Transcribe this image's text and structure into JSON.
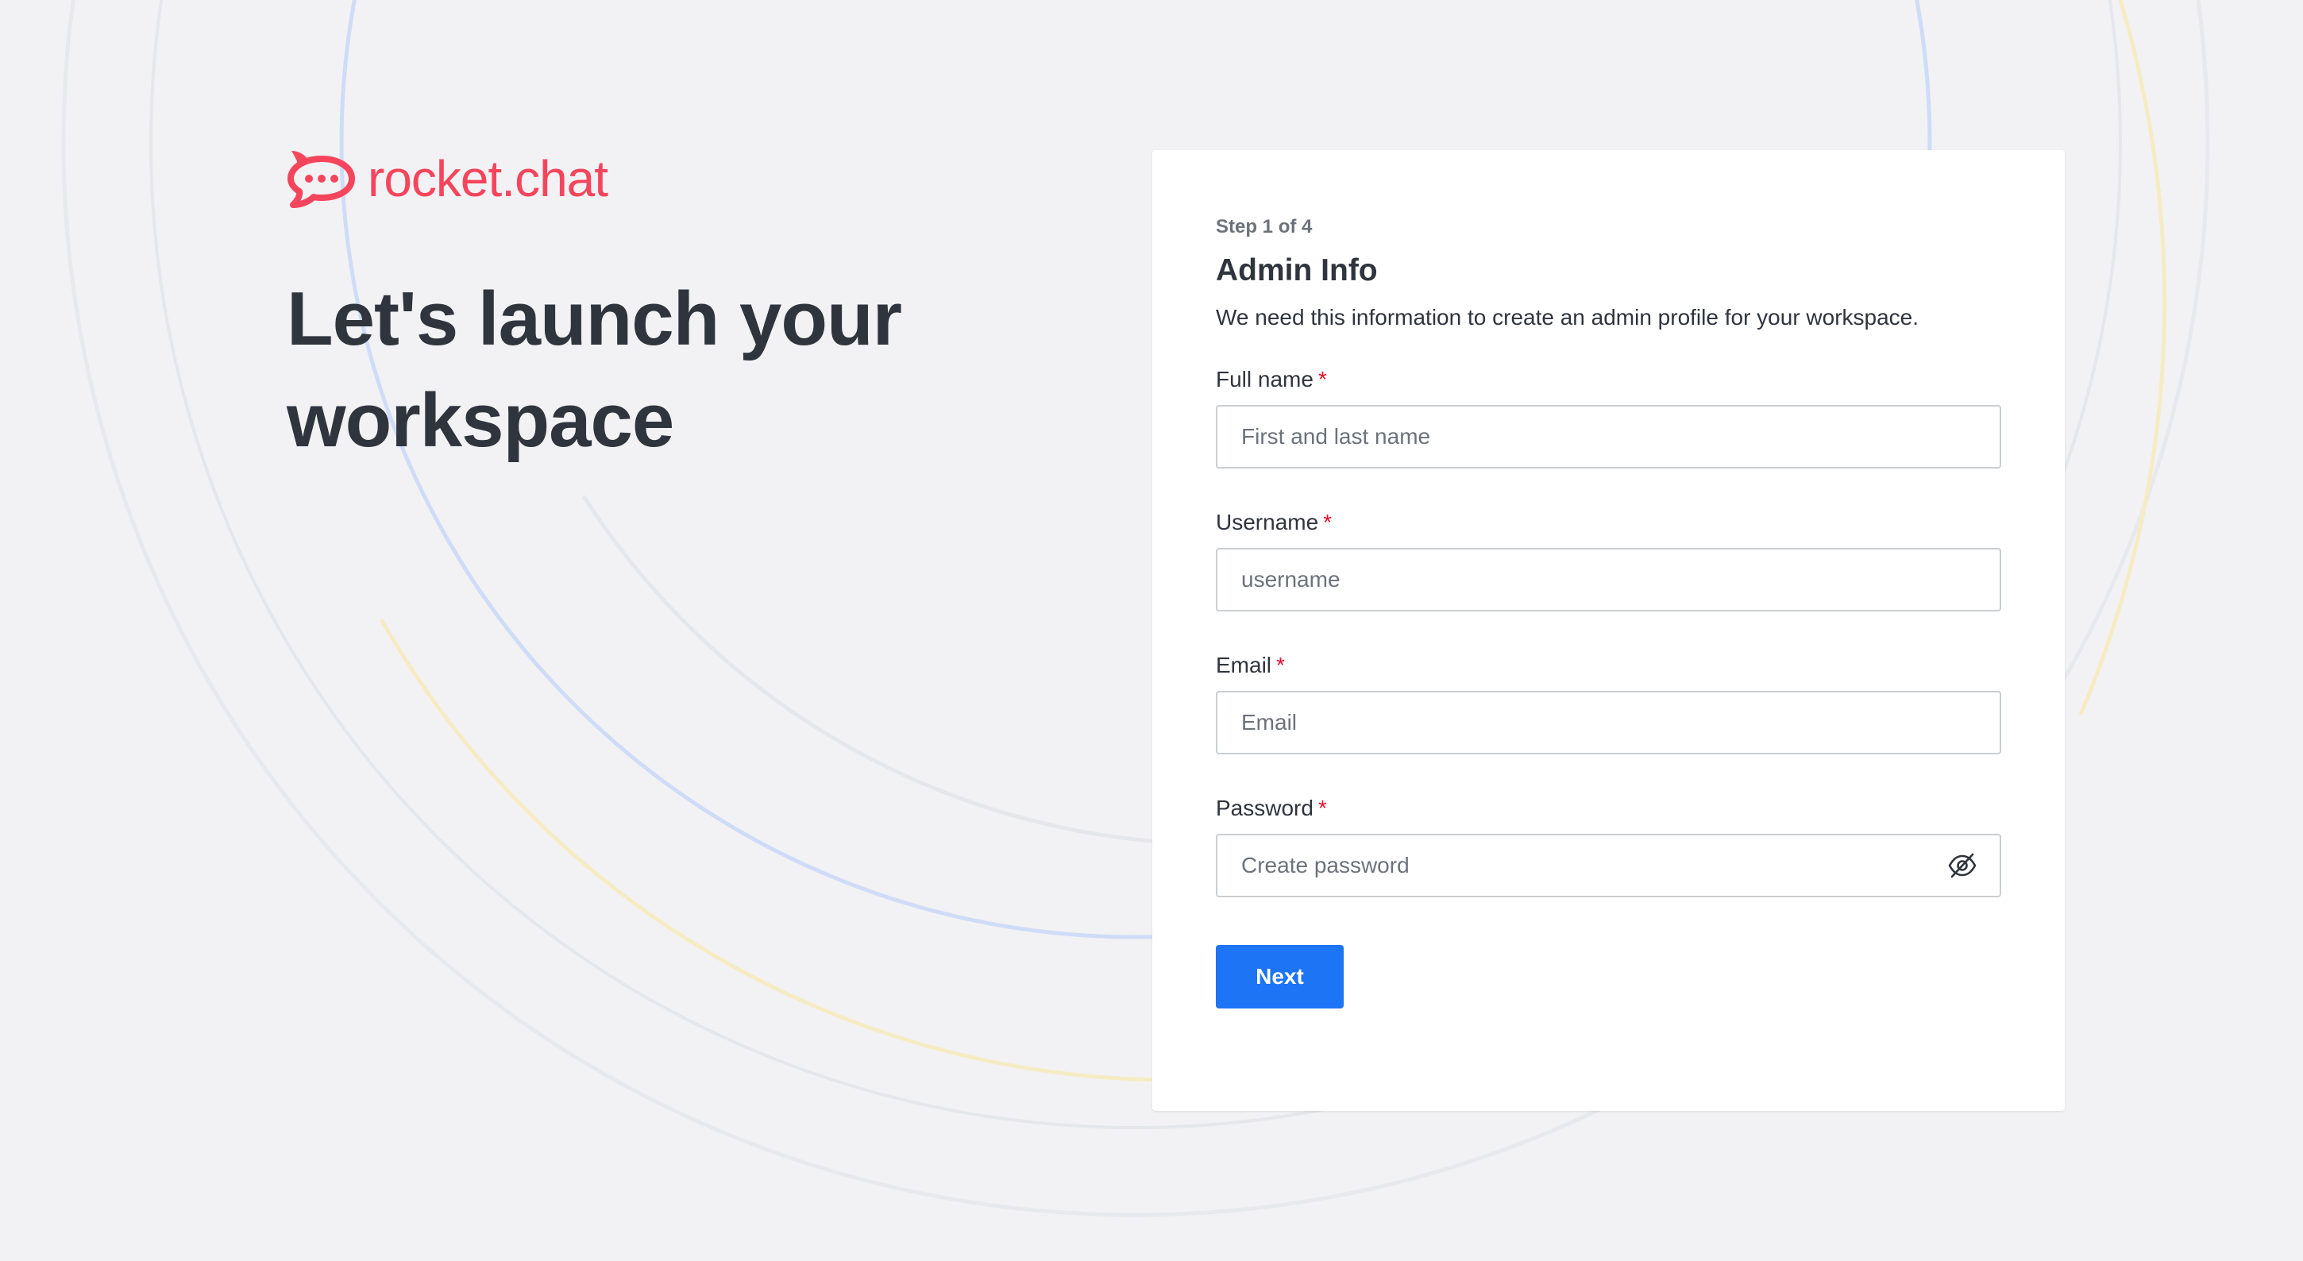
{
  "brand": {
    "name": "rocket.chat",
    "logo_icon": "rocket-chat-logo-icon",
    "color": "#f5455c"
  },
  "hero": {
    "title": "Let's launch your workspace"
  },
  "form": {
    "step": "Step 1 of 4",
    "title": "Admin Info",
    "description": "We need this information to create an admin profile for your workspace.",
    "required_marker": "*",
    "fields": {
      "full_name": {
        "label": "Full name",
        "placeholder": "First and last name",
        "value": ""
      },
      "username": {
        "label": "Username",
        "placeholder": "username",
        "value": ""
      },
      "email": {
        "label": "Email",
        "placeholder": "Email",
        "value": ""
      },
      "password": {
        "label": "Password",
        "placeholder": "Create password",
        "value": "",
        "toggle_icon": "eye-off-icon"
      }
    },
    "next_label": "Next"
  },
  "colors": {
    "accent": "#1d74f5",
    "required": "#ec0d2a",
    "text": "#2f343d",
    "background": "#f2f2f4"
  }
}
